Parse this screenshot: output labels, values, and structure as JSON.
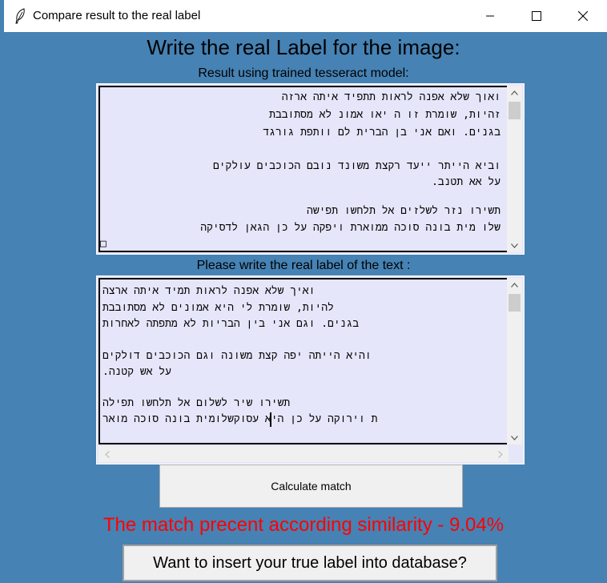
{
  "window": {
    "title": "Compare result to the real label",
    "icon": "feather-icon"
  },
  "heading": "Write the real Label for the image:",
  "ocr_label": "Result using trained tesseract model:",
  "ocr_lines": [
    "ואוך שלא אפנה לראות תתפיד איתה ארזה",
    "זהיות, שומרת זו ה יאו אמונ לא מסתובבת",
    "בגנים. ואם אני בן הברית לם וותפת גורגד",
    "",
    "וביא הייתר ייעד רקצת משונד נובם הכוכבים עולקים",
    "על אא תטנב.",
    "",
    "תשירו נזר לשלזים אל תלחשו תפישה",
    "שלו מית בונה סוכה ממוארת ויפקה על כן הגאן לדסיקה",
    "□"
  ],
  "real_label_prompt": "Please write the real label of the text :",
  "real_lines": [
    "ואיך שלא אפנה לראות תמיד איתה ארצה",
    "להיות, שומרת לי היא אמונים לא מסתובבת",
    "בגנים. וגם אני בין הבריות לא מתפתה לאחרות",
    "",
    "והיא הייתה יפה קצת משונה וגם הכוכבים דולקים",
    "על אש קטנה.",
    "",
    "תשירו שיר לשלום אל תלחשו תפילה",
    "ת וירוקה על כן היא עסוקשלומית בונה סוכה מואר"
  ],
  "buttons": {
    "calculate": "Calculate match",
    "insert": "Want to insert your true label into database?"
  },
  "result_text": "The match precent according similarity - 9.04%",
  "colors": {
    "background": "#4682b4",
    "text_area": "#e6e6fa",
    "result": "#ff0000"
  }
}
